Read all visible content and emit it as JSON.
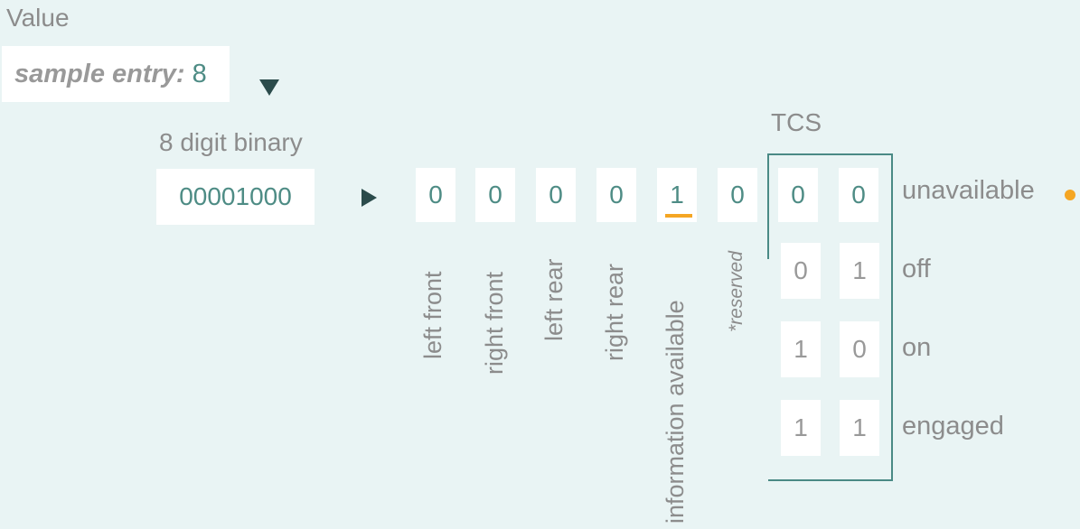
{
  "value_label": "Value",
  "sample_entry": {
    "label": "sample entry:",
    "value": "8"
  },
  "binary": {
    "label": "8 digit binary",
    "value": "00001000"
  },
  "bits": [
    "0",
    "0",
    "0",
    "0",
    "1",
    "0"
  ],
  "bit_labels": [
    "left front",
    "right front",
    "left rear",
    "right rear",
    "information available",
    "*reserved"
  ],
  "tcs": {
    "label": "TCS",
    "current": [
      "0",
      "0"
    ],
    "rows": [
      {
        "bits": [
          "0",
          "1"
        ],
        "state": "off"
      },
      {
        "bits": [
          "1",
          "0"
        ],
        "state": "on"
      },
      {
        "bits": [
          "1",
          "1"
        ],
        "state": "engaged"
      }
    ],
    "current_state": "unavailable"
  },
  "colors": {
    "background": "#e9f4f4",
    "value_text": "#4e8c85",
    "highlight": "#f5a623",
    "arrow": "#2b4b4b"
  },
  "icons": {
    "expand": "triangle-down-icon",
    "flow": "triangle-right-icon"
  }
}
